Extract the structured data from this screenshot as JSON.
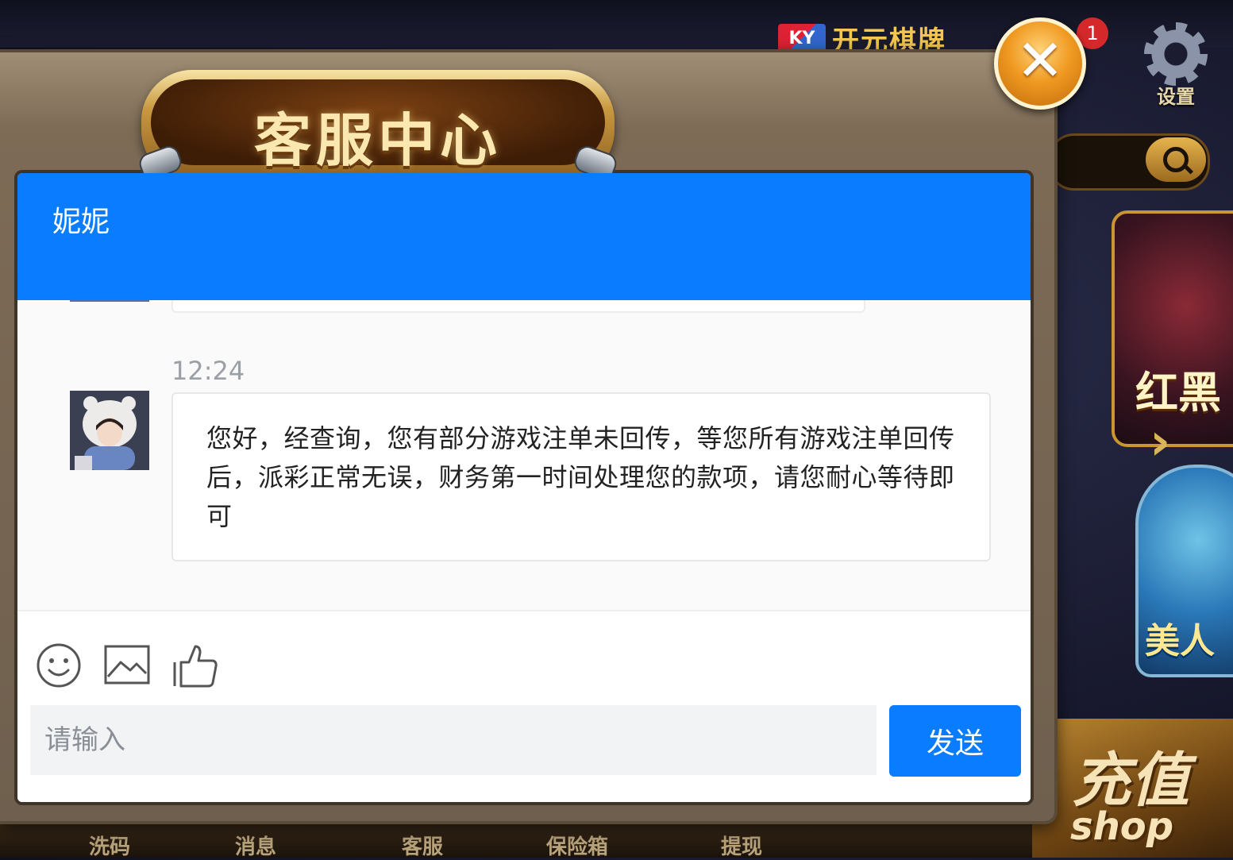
{
  "lobby": {
    "logo_badge": "KY",
    "logo_text": "开元棋牌",
    "notification_count": "1",
    "settings_label": "设置",
    "game_tiles": [
      "红黑",
      "美人"
    ],
    "shop_title": "充值",
    "shop_subtitle": "shop",
    "nav_items": [
      "洗码",
      "消息",
      "客服",
      "保险箱",
      "提现"
    ]
  },
  "dialog": {
    "title": "客服中心",
    "close_symbol": "✕"
  },
  "chat": {
    "agent_name": "妮妮",
    "messages": [
      {
        "time": "12:24",
        "text": "您好，经查询，您有部分游戏注单未回传，等您所有游戏注单回传后，派彩正常无误，财务第一时间处理您的款项，请您耐心等待即可"
      }
    ],
    "toolbar": [
      "emoji-icon",
      "image-icon",
      "thumbs-up-icon"
    ],
    "input_placeholder": "请输入",
    "input_value": "",
    "send_label": "发送",
    "accent_color": "#0a7cff"
  }
}
